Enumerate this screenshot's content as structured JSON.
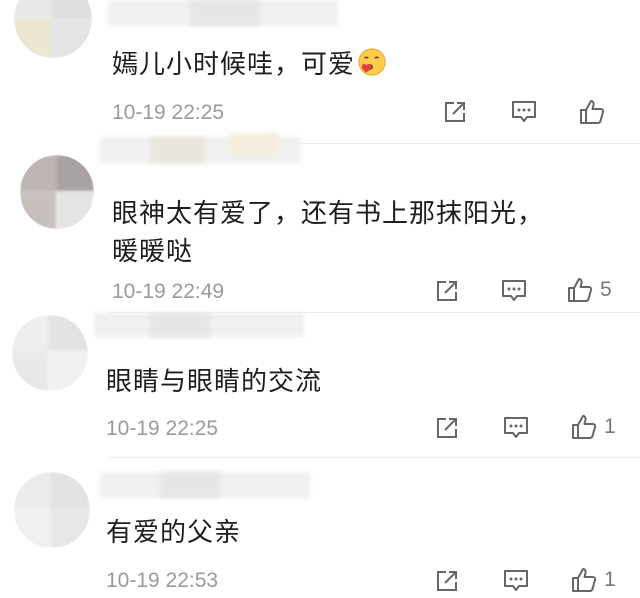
{
  "comments": [
    {
      "text": "嫣儿小时候哇，可爱",
      "emoji": "kissing-heart-emoji",
      "time": "10-19 22:25",
      "likes": ""
    },
    {
      "text_line1": "眼神太有爱了，还有书上那抹阳光，",
      "text_line2": "暖暖哒",
      "time": "10-19 22:49",
      "likes": "5"
    },
    {
      "text": "眼睛与眼睛的交流",
      "time": "10-19 22:25",
      "likes": "1"
    },
    {
      "text": "有爱的父亲",
      "time": "10-19 22:53",
      "likes": "1"
    }
  ],
  "colors": {
    "text": "#1e1e1e",
    "meta": "#9a9a9a",
    "icon": "#666666",
    "divider": "#ececec"
  },
  "icons": [
    "share-icon",
    "comment-icon",
    "like-icon"
  ]
}
